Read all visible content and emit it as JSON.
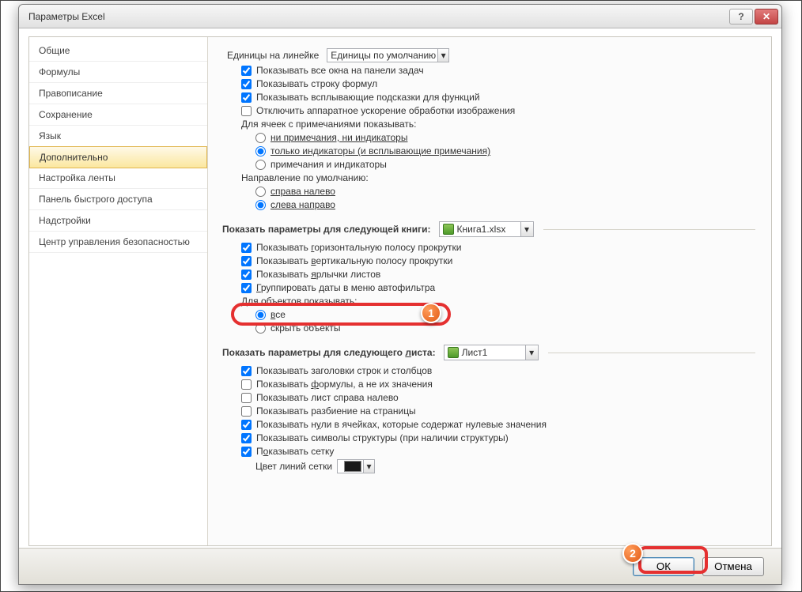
{
  "window": {
    "title": "Параметры Excel"
  },
  "sidebar": {
    "items": [
      "Общие",
      "Формулы",
      "Правописание",
      "Сохранение",
      "Язык",
      "Дополнительно",
      "Настройка ленты",
      "Панель быстрого доступа",
      "Надстройки",
      "Центр управления безопасностью"
    ],
    "selected_index": 5
  },
  "ruler_units": {
    "label": "Единицы на линейке",
    "value": "Единицы по умолчанию"
  },
  "display_checks": {
    "c1": "Показывать все окна на панели задач",
    "c2": "Показывать строку формул",
    "c3": "Показывать всплывающие подсказки для функций",
    "c4": "Отключить аппаратное ускорение обработки изображения"
  },
  "comments": {
    "label": "Для ячеек с примечаниями показывать:",
    "r1": "ни примечания, ни индикаторы",
    "r2": "только индикаторы (и всплывающие примечания)",
    "r3": "примечания и индикаторы"
  },
  "direction": {
    "label": "Направление по умолчанию:",
    "r1": "справа налево",
    "r2": "слева направо"
  },
  "book_group": {
    "label": "Показать параметры для следующей книги:",
    "value": "Книга1.xlsx",
    "c1": {
      "pre": "Показывать ",
      "u": "г",
      "rest": "оризонтальную полосу прокрутки"
    },
    "c2": {
      "pre": "Показывать ",
      "u": "в",
      "rest": "ертикальную полосу прокрутки"
    },
    "c3": {
      "pre": "Показывать ",
      "u": "я",
      "rest": "рлычки листов"
    },
    "c4": {
      "u": "Г",
      "rest": "руппировать даты в меню автофильтра"
    },
    "obj_label": "Для объектов показывать:",
    "ro1": {
      "u": "в",
      "rest": "се"
    },
    "ro2": "скрыть объекты"
  },
  "sheet_group": {
    "label": {
      "pre": "Показать параметры для следующего ",
      "u": "л",
      "rest": "иста:"
    },
    "value": "Лист1",
    "c1": "Показывать заголовки строк и столбцов",
    "c2": {
      "pre": "Показывать ",
      "u": "ф",
      "rest": "ормулы, а не их значения"
    },
    "c3": "Показывать лист справа налево",
    "c4": "Показывать разбиение на страницы",
    "c5": {
      "pre": "Показывать н",
      "u": "у",
      "rest": "ли в ячейках, которые содержат нулевые значения"
    },
    "c6": "Показывать символы структуры (при наличии структуры)",
    "c7": {
      "pre": "П",
      "u": "о",
      "rest": "казывать сетку"
    },
    "gridcolor_label": "Цвет линий сетки"
  },
  "buttons": {
    "ok": "ОК",
    "cancel": "Отмена"
  },
  "callouts": {
    "b1": "1",
    "b2": "2"
  }
}
